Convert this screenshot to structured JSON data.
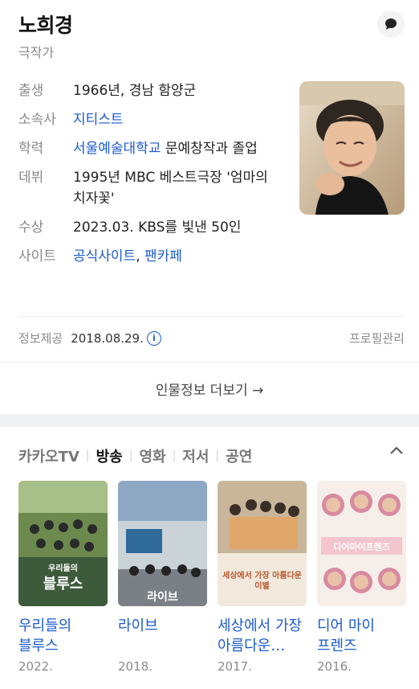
{
  "person": {
    "name": "노희경",
    "job": "극작가"
  },
  "info": {
    "birth_label": "출생",
    "birth_value": "1966년, 경남 함양군",
    "agency_label": "소속사",
    "agency_value": "지티스트",
    "edu_label": "학력",
    "edu_link": "서울예술대학교",
    "edu_rest": " 문예창작과 졸업",
    "debut_label": "데뷔",
    "debut_value": "1995년 MBC 베스트극장 '엄마의 치자꽃'",
    "award_label": "수상",
    "award_value": "2023.03. KBS를 빛낸 50인",
    "site_label": "사이트",
    "site_link1": "공식사이트",
    "site_sep": ", ",
    "site_link2": "팬카페"
  },
  "footer": {
    "source_label": "정보제공",
    "source_date": "2018.08.29.",
    "info_icon_glyph": "i",
    "profile_manage": "프로필관리",
    "more_link": "인물정보 더보기 →"
  },
  "tabs": {
    "kakaotv": "카카오TV",
    "broadcast": "방송",
    "movie": "영화",
    "book": "저서",
    "performance": "공연",
    "sep": "|"
  },
  "works": [
    {
      "title": "우리들의 블루스",
      "year": "2022.",
      "poster_text": "블루스",
      "poster_sub": "우리들의"
    },
    {
      "title": "라이브",
      "year": "2018.",
      "poster_text": "라이브",
      "poster_sub": ""
    },
    {
      "title": "세상에서 가장 아름다운…",
      "year": "2017.",
      "poster_text": "세상에서 가장 아름다운 이별",
      "poster_sub": ""
    },
    {
      "title": "디어 마이 프렌즈",
      "year": "2016.",
      "poster_text": "디어마이프렌즈",
      "poster_sub": ""
    }
  ],
  "colors": {
    "link": "#1a5acf",
    "muted": "#8a8a8a"
  }
}
